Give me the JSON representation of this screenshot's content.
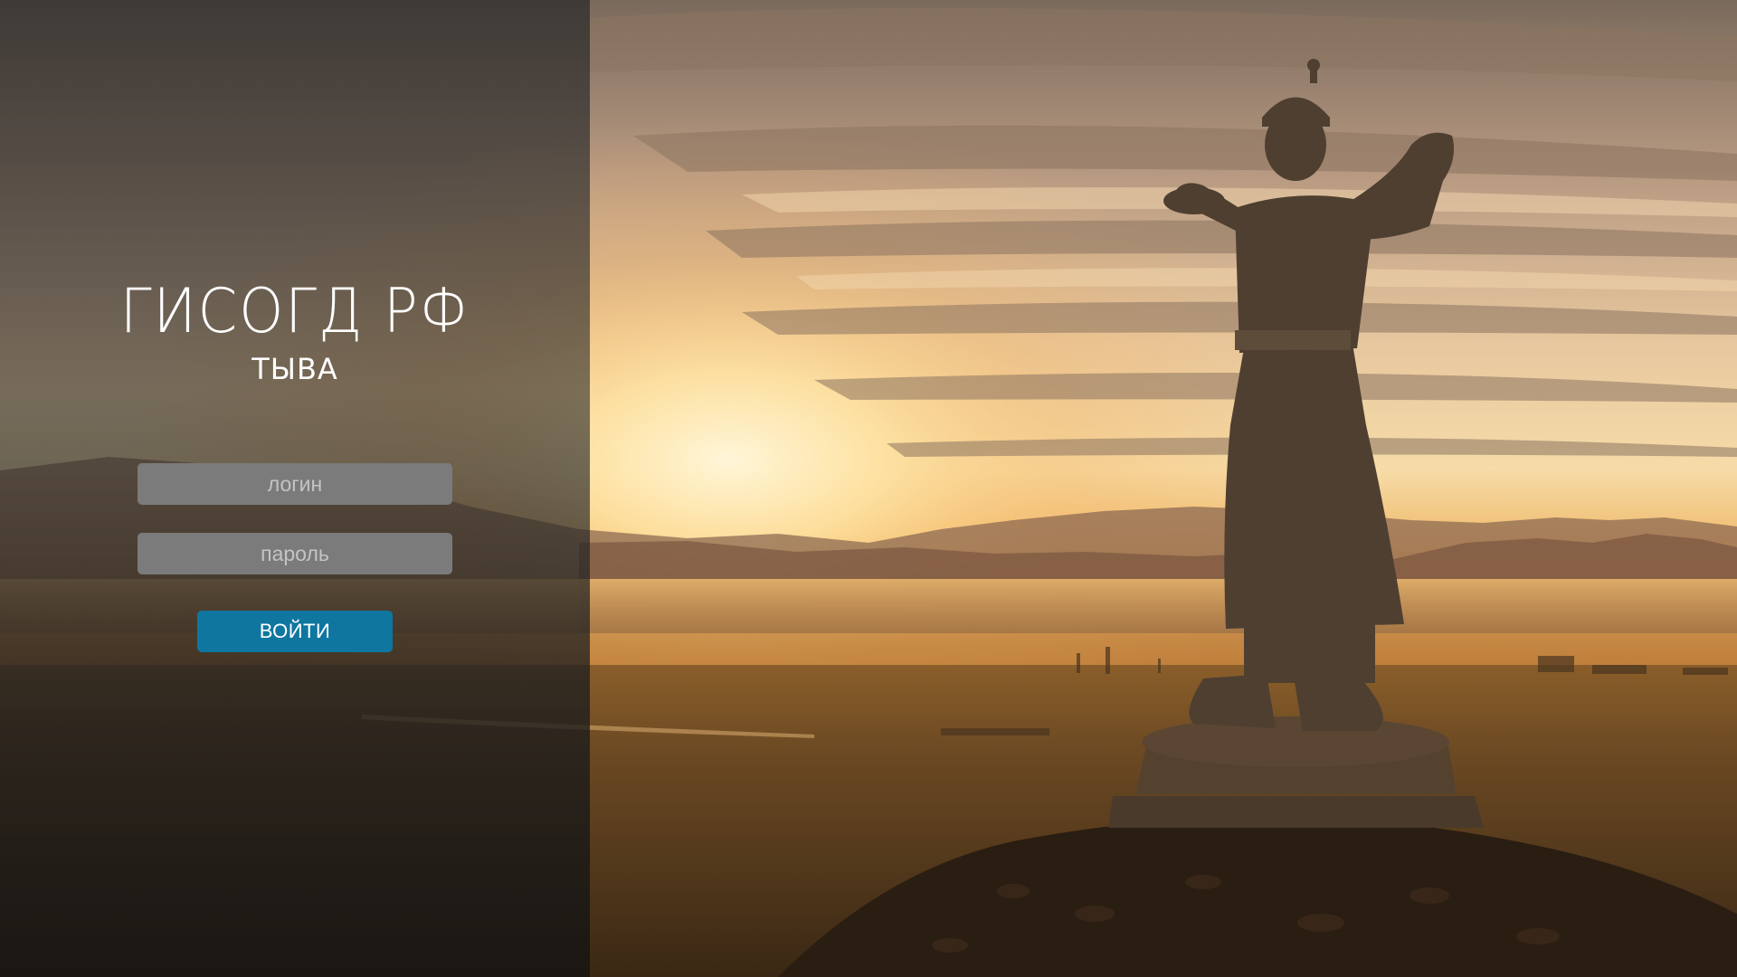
{
  "app": {
    "title": "ГИСОГД РФ",
    "region": "ТЫВА"
  },
  "login_form": {
    "login_placeholder": "логин",
    "password_placeholder": "пароль",
    "submit_label": "ВОЙТИ"
  },
  "colors": {
    "accent": "#0f76a0",
    "field_background": "#7b7b7b",
    "panel_overlay": "#2d2d2d"
  }
}
